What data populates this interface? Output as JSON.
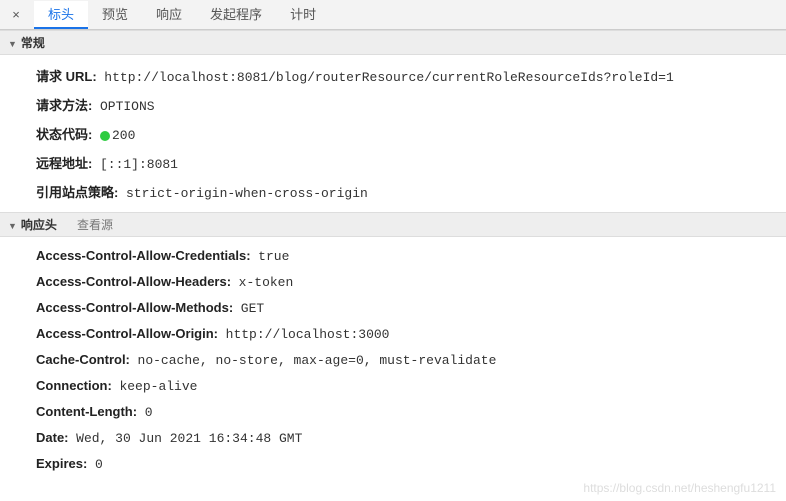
{
  "toolbar": {
    "close_glyph": "×",
    "tabs": [
      {
        "label": "标头",
        "active": true
      },
      {
        "label": "预览",
        "active": false
      },
      {
        "label": "响应",
        "active": false
      },
      {
        "label": "发起程序",
        "active": false
      },
      {
        "label": "计时",
        "active": false
      }
    ]
  },
  "sections": {
    "general": {
      "title": "常规",
      "rows": [
        {
          "label": "请求 URL:",
          "value": "http://localhost:8081/blog/routerResource/currentRoleResourceIds?roleId=1"
        },
        {
          "label": "请求方法:",
          "value": "OPTIONS"
        },
        {
          "label": "状态代码:",
          "value": "200",
          "status_dot": true
        },
        {
          "label": "远程地址:",
          "value": "[::1]:8081"
        },
        {
          "label": "引用站点策略:",
          "value": "strict-origin-when-cross-origin"
        }
      ]
    },
    "response_headers": {
      "title": "响应头",
      "view_source": "查看源",
      "rows": [
        {
          "label": "Access-Control-Allow-Credentials:",
          "value": "true"
        },
        {
          "label": "Access-Control-Allow-Headers:",
          "value": "x-token"
        },
        {
          "label": "Access-Control-Allow-Methods:",
          "value": "GET"
        },
        {
          "label": "Access-Control-Allow-Origin:",
          "value": "http://localhost:3000"
        },
        {
          "label": "Cache-Control:",
          "value": "no-cache, no-store, max-age=0, must-revalidate"
        },
        {
          "label": "Connection:",
          "value": "keep-alive"
        },
        {
          "label": "Content-Length:",
          "value": "0"
        },
        {
          "label": "Date:",
          "value": "Wed, 30 Jun 2021 16:34:48 GMT"
        },
        {
          "label": "Expires:",
          "value": "0"
        }
      ]
    }
  },
  "watermark": "https://blog.csdn.net/heshengfu1211"
}
